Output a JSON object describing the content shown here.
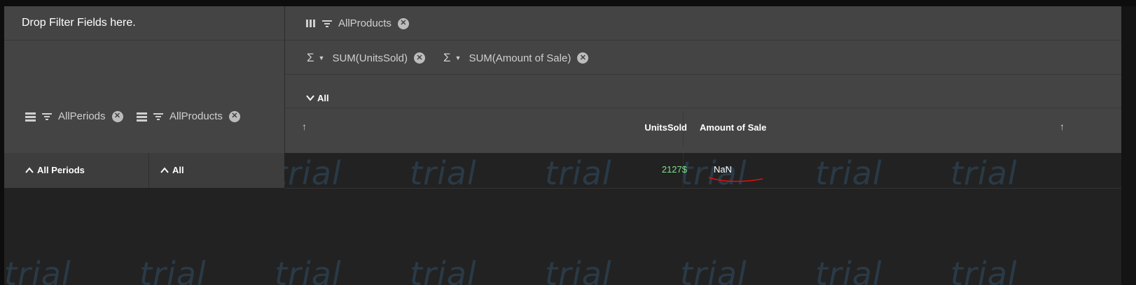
{
  "filter_area": {
    "placeholder": "Drop Filter Fields here."
  },
  "columns_area": {
    "fields": [
      {
        "label": "AllProducts",
        "icon": "column-icon"
      }
    ]
  },
  "values_area": {
    "measures": [
      {
        "label": "SUM(UnitsSold)",
        "icon": "sigma-icon"
      },
      {
        "label": "SUM(Amount of Sale)",
        "icon": "sigma-icon"
      }
    ]
  },
  "column_header": {
    "member": "All"
  },
  "rows_area": {
    "fields": [
      {
        "label": "AllPeriods",
        "icon": "rows-icon"
      },
      {
        "label": "AllProducts",
        "icon": "rows-icon"
      }
    ]
  },
  "grid": {
    "headers": [
      "UnitsSold",
      "Amount of Sale"
    ],
    "rows": [
      {
        "period": "All Periods",
        "product": "All",
        "units_sold": "2127$",
        "amount_of_sale": "NaN"
      }
    ]
  },
  "watermark": "trial",
  "colors": {
    "panel": "#444444",
    "body": "#222222",
    "value_green": "#7ee08a",
    "annotation": "#e01010"
  }
}
